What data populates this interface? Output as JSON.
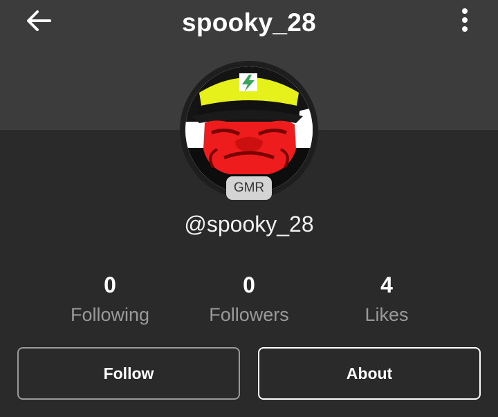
{
  "header": {
    "title": "spooky_28",
    "back_icon": "arrow-left-icon",
    "more_icon": "more-vertical-icon"
  },
  "profile": {
    "handle": "@spooky_28",
    "badge": "GMR",
    "avatar": "red-character-with-yellow-cap-avatar"
  },
  "stats": [
    {
      "value": "0",
      "label": "Following"
    },
    {
      "value": "0",
      "label": "Followers"
    },
    {
      "value": "4",
      "label": "Likes"
    }
  ],
  "actions": {
    "follow_label": "Follow",
    "about_label": "About"
  },
  "colors": {
    "background": "#2a2a2a",
    "header": "#3c3c3c",
    "label_gray": "#9a9a9a",
    "badge_bg": "#d4d4d4"
  }
}
